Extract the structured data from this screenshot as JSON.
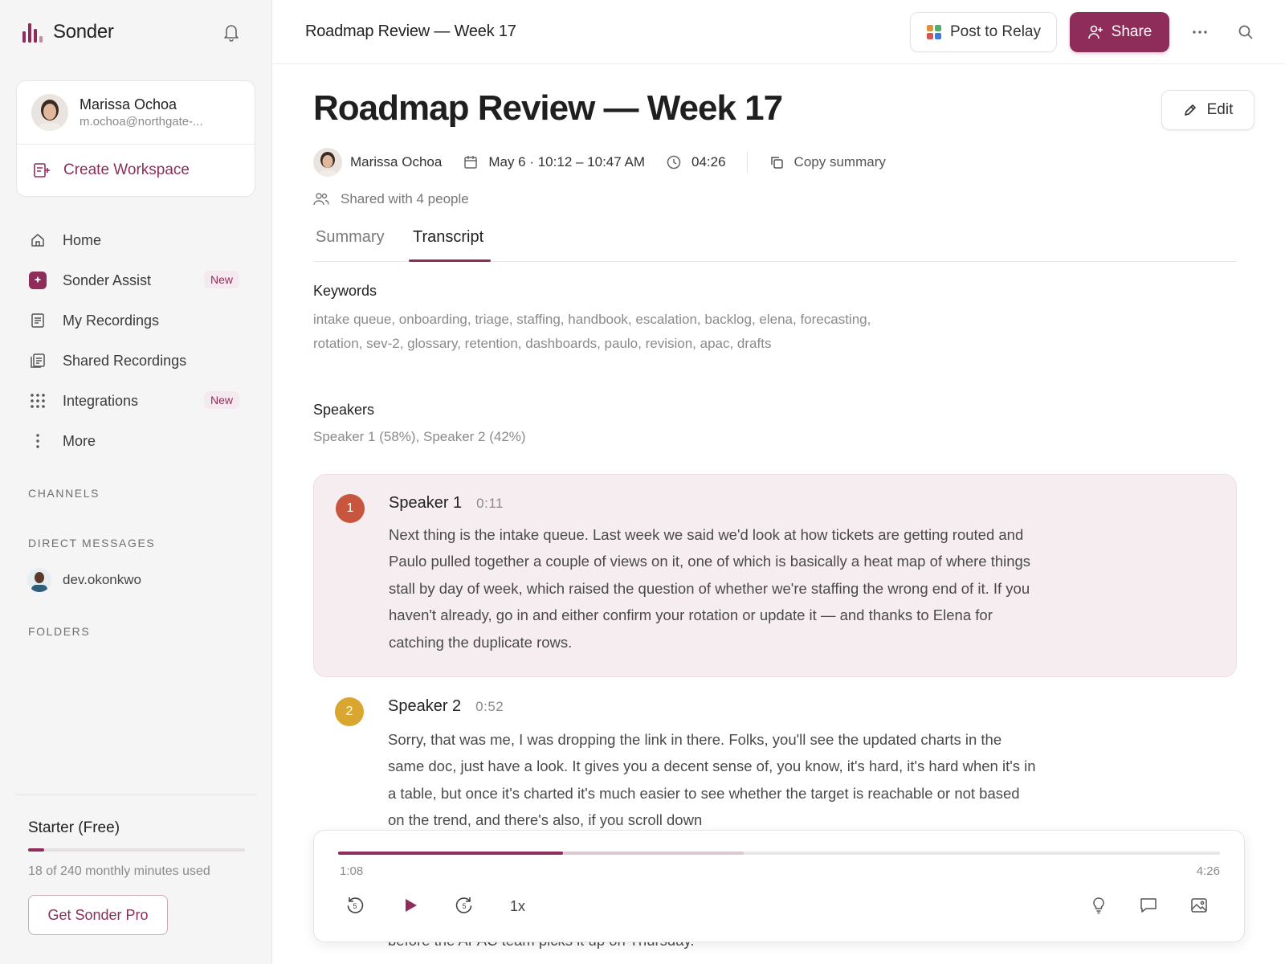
{
  "app": {
    "name": "Sonder",
    "brand_color": "#8e2d5a"
  },
  "account": {
    "name": "Marissa Ochoa",
    "email": "m.ochoa@northgate-..."
  },
  "sidebar": {
    "create_workspace": "Create Workspace",
    "nav": [
      {
        "label": "Home",
        "icon": "home-icon"
      },
      {
        "label": "Sonder Assist",
        "icon": "sparkle-icon",
        "badge": "New"
      },
      {
        "label": "My Recordings",
        "icon": "document-icon"
      },
      {
        "label": "Shared Recordings",
        "icon": "documents-icon"
      },
      {
        "label": "Integrations",
        "icon": "grid-icon",
        "badge": "New"
      },
      {
        "label": "More",
        "icon": "more-vertical-icon"
      }
    ],
    "channels_label": "CHANNELS",
    "dm_label": "DIRECT MESSAGES",
    "dm_items": [
      {
        "label": "dev.okonkwo"
      }
    ],
    "folders_label": "FOLDERS"
  },
  "plan": {
    "title": "Starter (Free)",
    "usage": "18 of 240 monthly minutes used",
    "used_fraction": 0.075,
    "cta": "Get Sonder Pro"
  },
  "topbar": {
    "title": "Roadmap Review — Week 17",
    "relay_label": "Post to Relay",
    "share_label": "Share"
  },
  "recording": {
    "title": "Roadmap Review — Week 17",
    "edit_label": "Edit",
    "owner": "Marissa Ochoa",
    "datetime": "May 6 · 10:12 – 10:47 AM",
    "duration": "04:26",
    "copy_label": "Copy summary",
    "shared_with": "Shared with 4 people"
  },
  "tabs": [
    {
      "label": "Summary",
      "active": false
    },
    {
      "label": "Transcript",
      "active": true
    }
  ],
  "keywords": {
    "title": "Keywords",
    "text": "intake queue, onboarding, triage, staffing, handbook, escalation, backlog, elena, forecasting, rotation, sev-2, glossary, retention, dashboards, paulo, revision, apac, drafts"
  },
  "speakers": {
    "title": "Speakers",
    "text": "Speaker 1 (58%), Speaker 2 (42%)"
  },
  "transcript": [
    {
      "num": "1",
      "speaker": "Speaker 1",
      "time": "0:11",
      "color": "#c8553d",
      "text": "Next thing is the intake queue. Last week we said we'd look at how tickets are getting routed and Paulo pulled together a couple of views on it, one of which is basically a heat map of where things stall by day of week, which raised the question of whether we're staffing the wrong end of it. If you haven't already, go in and either confirm your rotation or update it — and thanks to Elena for catching the duplicate rows."
    },
    {
      "num": "2",
      "speaker": "Speaker 2",
      "time": "0:52",
      "color": "#d9a630",
      "text": "Sorry, that was me, I was dropping the link in there. Folks, you'll see the updated charts in the same doc, just have a look. It gives you a decent sense of, you know, it's hard, it's hard when it's in a table, but once it's charted it's much easier to see whether the target is reachable or not based on the trend, and there's also, if you scroll down"
    }
  ],
  "cut_text": "before the APAC team picks it up on Thursday.",
  "player": {
    "position": "1:08",
    "duration": "4:26",
    "progress_fraction": 0.255,
    "buffered_fraction": 0.46,
    "speed": "1x"
  }
}
